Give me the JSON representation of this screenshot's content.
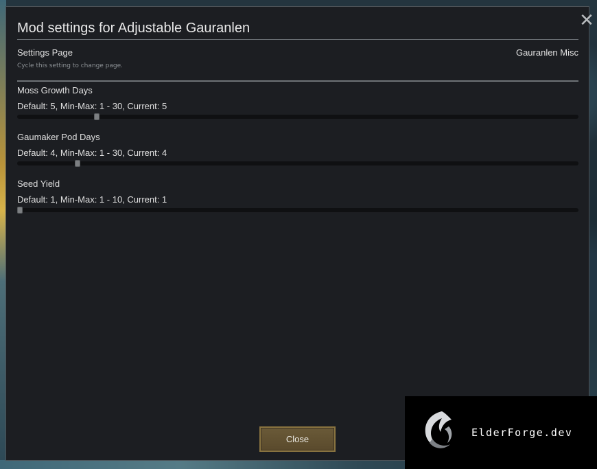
{
  "dialog": {
    "title": "Mod settings for Adjustable Gauranlen",
    "close_icon": "close-x-icon"
  },
  "settings_page": {
    "label": "Settings Page",
    "value": "Gauranlen Misc",
    "hint": "Cycle this setting to change page."
  },
  "settings": [
    {
      "name": "Moss Growth Days",
      "description": "Default: 5, Min-Max: 1 - 30, Current: 5",
      "default": 5,
      "min": 1,
      "max": 30,
      "current": 5
    },
    {
      "name": "Gaumaker Pod Days",
      "description": "Default: 4, Min-Max: 1 - 30, Current: 4",
      "default": 4,
      "min": 1,
      "max": 30,
      "current": 4
    },
    {
      "name": "Seed Yield",
      "description": "Default: 1, Min-Max: 1 - 10, Current: 1",
      "default": 1,
      "min": 1,
      "max": 10,
      "current": 1
    }
  ],
  "footer": {
    "close_label": "Close"
  },
  "watermark": {
    "text": "ElderForge.dev",
    "logo_icon": "dragon-swirl-logo"
  },
  "colors": {
    "dialog_bg": "#1c1e22",
    "button_bg": "#5f4f30",
    "button_border": "#8a7440",
    "text": "#e0e0e0"
  }
}
